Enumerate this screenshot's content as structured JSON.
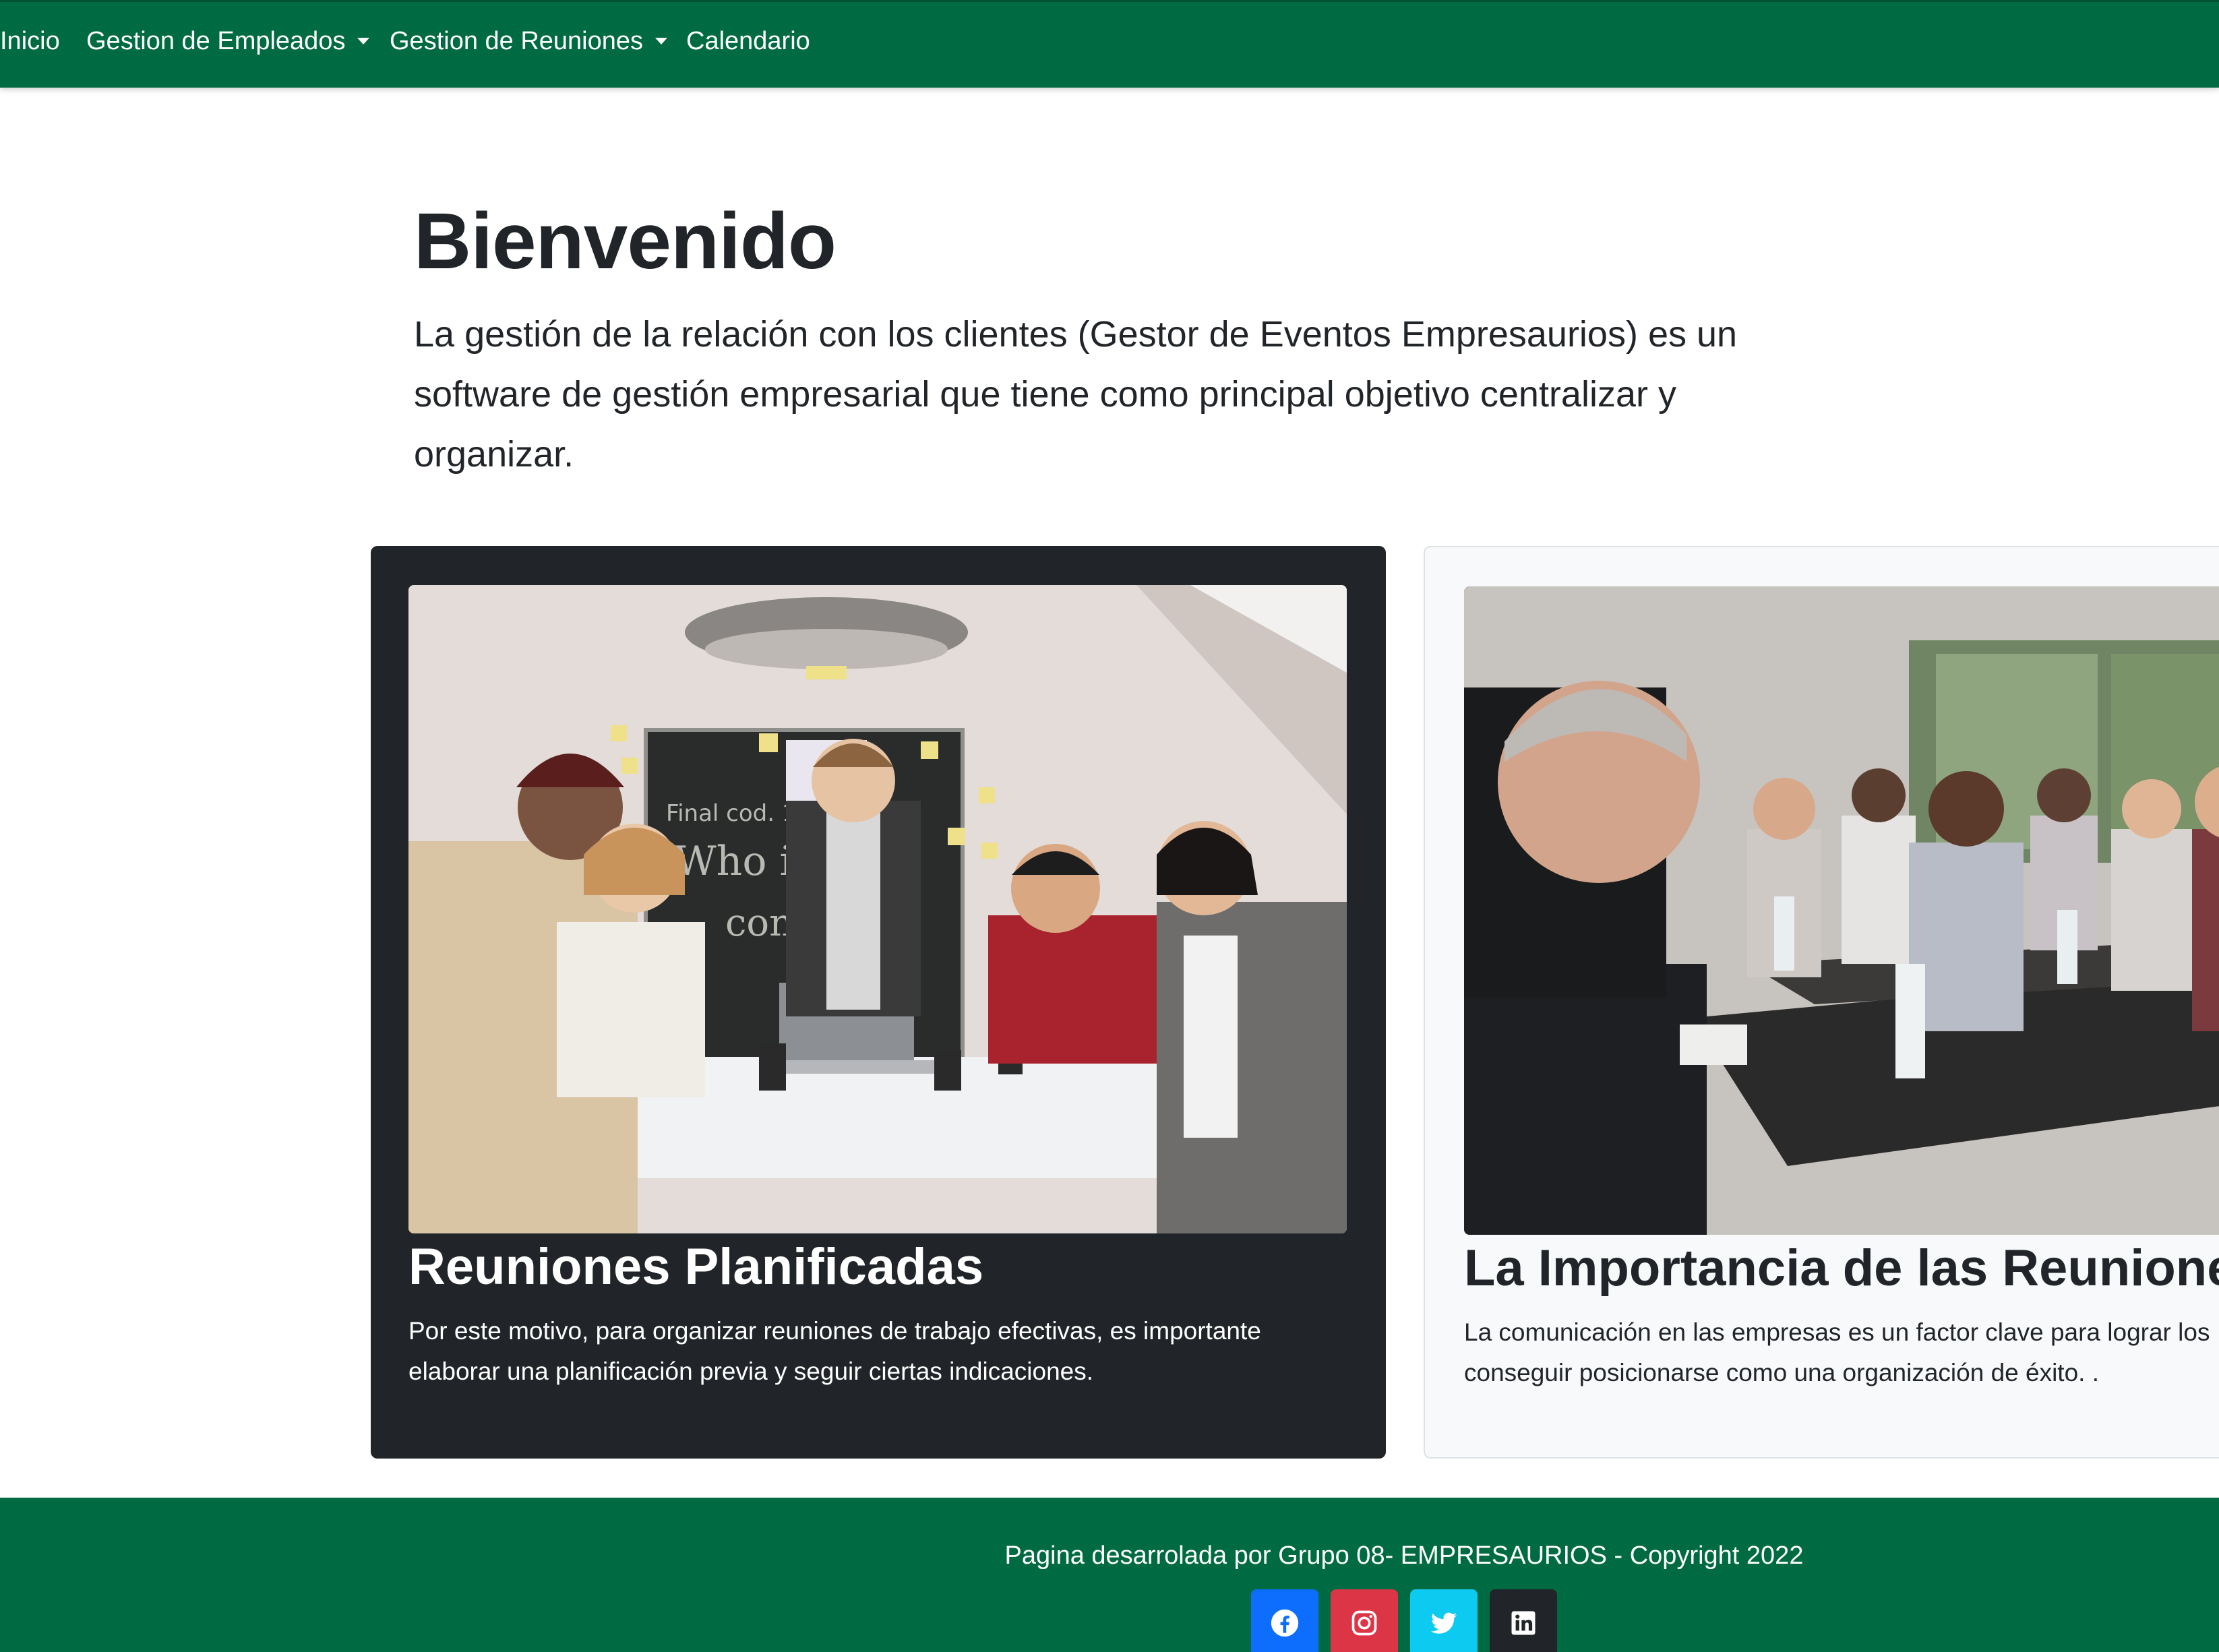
{
  "nav": {
    "items": [
      {
        "label": "Inicio",
        "dropdown": false
      },
      {
        "label": "Gestion de Empleados",
        "dropdown": true
      },
      {
        "label": "Gestion de Reuniones",
        "dropdown": true
      },
      {
        "label": "Calendario",
        "dropdown": false
      }
    ]
  },
  "hero": {
    "title": "Bienvenido",
    "lead": "La gestión de la relación con los clientes (Gestor de Eventos Empresaurios) es un software de gestión empresarial que tiene como principal objetivo centralizar y organizar."
  },
  "cards": [
    {
      "title": "Reuniones Planificadas",
      "text": "Por este motivo, para organizar reuniones de trabajo efectivas, es importante elaborar una planificación previa y seguir ciertas indicaciones.",
      "image": "team-meeting-photo",
      "theme": "dark"
    },
    {
      "title": "La Importancia de las Reuniones",
      "text_line1": "La comunicación en las empresas es un factor clave para lograr los",
      "text_line2": "conseguir posicionarse como una organización de éxito. .",
      "image": "conference-audience-photo",
      "theme": "light"
    }
  ],
  "footer": {
    "text": "Pagina desarrolada por Grupo 08- EMPRESAURIOS - Copyright 2022",
    "social": [
      {
        "icon": "facebook-icon",
        "color": "#0d6efd"
      },
      {
        "icon": "instagram-icon",
        "color": "#dc3545"
      },
      {
        "icon": "twitter-icon",
        "color": "#0dcaf0"
      },
      {
        "icon": "linkedin-icon",
        "color": "#212529"
      }
    ]
  },
  "colors": {
    "brand_green": "#006b42",
    "card_dark": "#212529",
    "card_light": "#f8f9fa"
  }
}
